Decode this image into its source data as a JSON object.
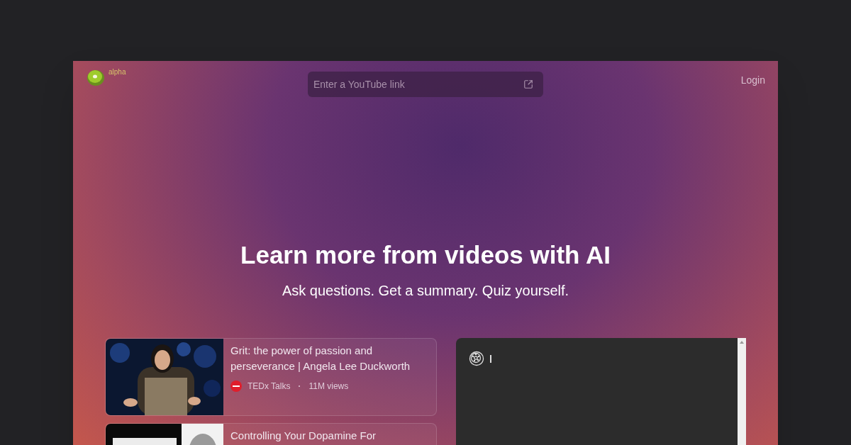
{
  "header": {
    "badge": "alpha",
    "search": {
      "placeholder": "Enter a YouTube link"
    },
    "login": "Login"
  },
  "hero": {
    "title": "Learn more from videos with AI",
    "subtitle": "Ask questions. Get a summary. Quiz yourself."
  },
  "videos": [
    {
      "kind": "picture",
      "title": "Grit: the power of passion and perseverance | Angela Lee Duckworth",
      "channel": "TEDx Talks",
      "views": "11M views"
    },
    {
      "kind": "picture",
      "title": "Controlling Your Dopamine For"
    }
  ]
}
